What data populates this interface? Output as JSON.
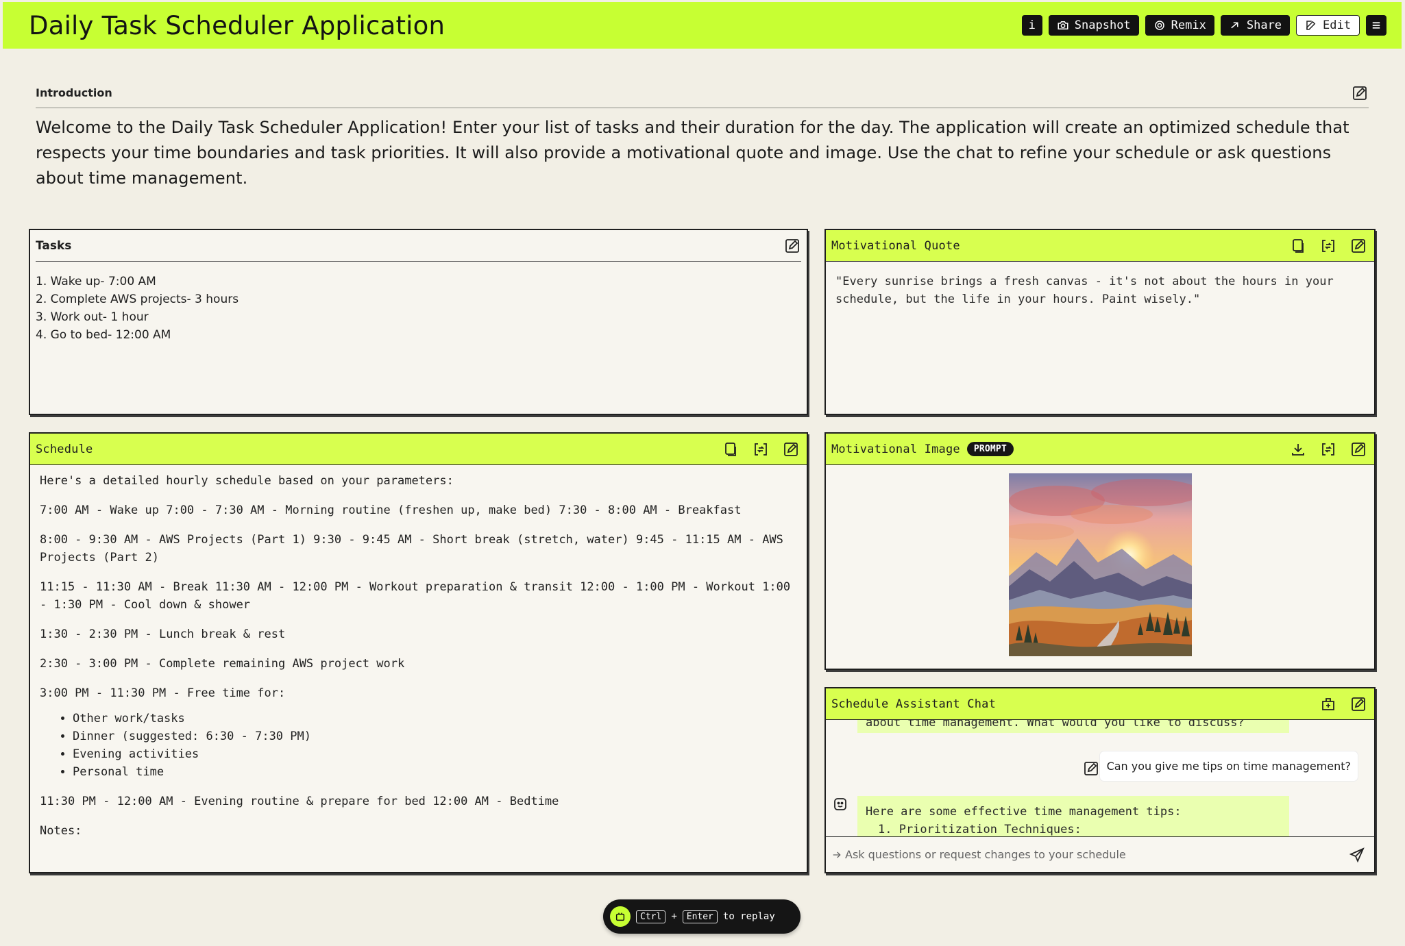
{
  "app": {
    "title": "Daily Task Scheduler Application",
    "accent": "#c7ff33"
  },
  "toolbar": {
    "info_label": "i",
    "snapshot_label": "Snapshot",
    "remix_label": "Remix",
    "share_label": "Share",
    "edit_label": "Edit"
  },
  "intro": {
    "label": "Introduction",
    "text": "Welcome to the Daily Task Scheduler Application! Enter your list of tasks and their duration for the day. The application will create an optimized schedule that respects your time boundaries and task priorities. It will also provide a motivational quote and image. Use the chat to refine your schedule or ask questions about time management."
  },
  "tasks": {
    "title": "Tasks",
    "items": [
      "1. Wake up- 7:00 AM",
      "2. Complete AWS projects- 3 hours",
      "3. Work out- 1 hour",
      "4. Go to bed- 12:00 AM"
    ]
  },
  "quote": {
    "title": "Motivational Quote",
    "text": "\"Every sunrise brings a fresh canvas - it's not about the hours in your schedule, but the life in your hours. Paint wisely.\""
  },
  "schedule": {
    "title": "Schedule",
    "intro": "Here's a detailed hourly schedule based on your parameters:",
    "block1": "7:00 AM - Wake up 7:00 - 7:30 AM - Morning routine (freshen up, make bed) 7:30 - 8:00 AM - Breakfast",
    "block2": "8:00 - 9:30 AM - AWS Projects (Part 1) 9:30 - 9:45 AM - Short break (stretch, water) 9:45 - 11:15 AM - AWS Projects (Part 2)",
    "block3": "11:15 - 11:30 AM - Break 11:30 AM - 12:00 PM - Workout preparation & transit 12:00 - 1:00 PM - Workout 1:00 - 1:30 PM - Cool down & shower",
    "block4": "1:30 - 2:30 PM - Lunch break & rest",
    "block5": "2:30 - 3:00 PM - Complete remaining AWS project work",
    "block6": "3:00 PM - 11:30 PM - Free time for:",
    "free_time": [
      "Other work/tasks",
      "Dinner (suggested: 6:30 - 7:30 PM)",
      "Evening activities",
      "Personal time"
    ],
    "block7": "11:30 PM - 12:00 AM - Evening routine & prepare for bed 12:00 AM - Bedtime",
    "notes_label": "Notes:"
  },
  "image": {
    "title": "Motivational Image",
    "badge": "PROMPT",
    "icon": "watercolor-sunset-mountains"
  },
  "chat": {
    "title": "Schedule Assistant Chat",
    "prev_ai_tail": "about time management. What would you like to discuss?",
    "user_message": "Can you give me tips on time management?",
    "ai_reply_line1": "Here are some effective time management tips:",
    "ai_reply_line2": "1. Prioritization Techniques:",
    "input_placeholder": "Ask questions or request changes to your schedule"
  },
  "replay": {
    "key1": "Ctrl",
    "plus": "+",
    "key2": "Enter",
    "suffix": "to replay"
  }
}
